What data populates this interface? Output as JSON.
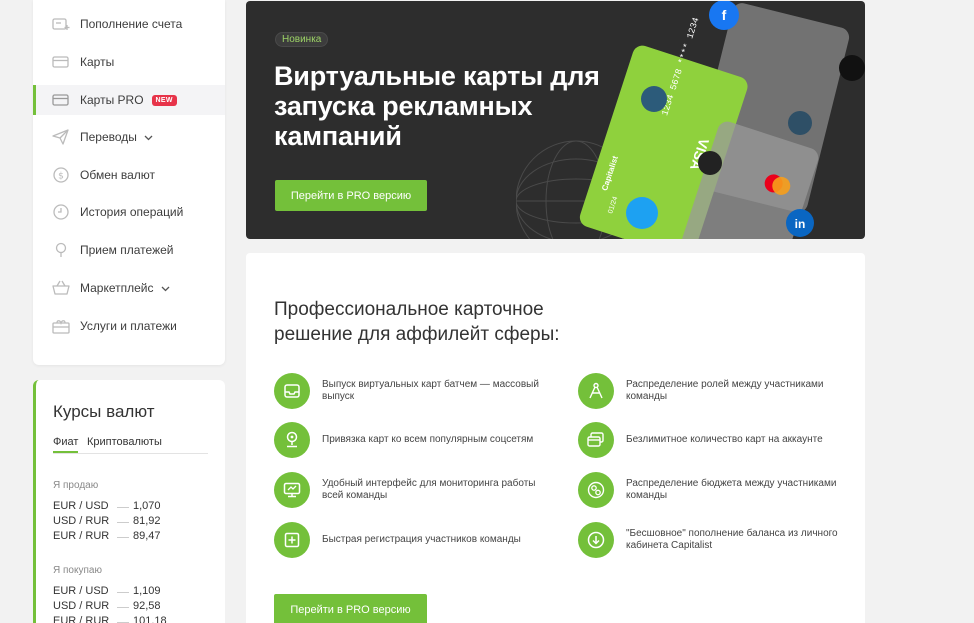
{
  "sidebar": {
    "items": [
      {
        "label": "Пополнение счета",
        "icon": "wallet-plus-icon"
      },
      {
        "label": "Карты",
        "icon": "card-icon"
      },
      {
        "label": "Карты PRO",
        "icon": "card-pro-icon",
        "badge": "NEW"
      },
      {
        "label": "Переводы",
        "icon": "send-icon"
      },
      {
        "label": "Обмен валют",
        "icon": "dollar-circle-icon"
      },
      {
        "label": "История операций",
        "icon": "clock-icon"
      },
      {
        "label": "Прием платежей",
        "icon": "pin-icon"
      },
      {
        "label": "Маркетплейс",
        "icon": "basket-icon"
      },
      {
        "label": "Услуги и платежи",
        "icon": "gift-icon"
      }
    ]
  },
  "rates": {
    "title": "Курсы валют",
    "tabs": [
      "Фиат",
      "Криптовалюты"
    ],
    "sell_label": "Я продаю",
    "buy_label": "Я покупаю",
    "sell": [
      {
        "pair": "EUR / USD",
        "value": "1,070"
      },
      {
        "pair": "USD / RUR",
        "value": "81,92"
      },
      {
        "pair": "EUR / RUR",
        "value": "89,47"
      }
    ],
    "buy": [
      {
        "pair": "EUR / USD",
        "value": "1,109"
      },
      {
        "pair": "USD / RUR",
        "value": "92,58"
      },
      {
        "pair": "EUR / RUR",
        "value": "101,18"
      }
    ]
  },
  "banner": {
    "tag": "Новинка",
    "title": "Виртуальные карты для запуска рекламных кампаний",
    "button": "Перейти в PRO версию",
    "card_brand": "Capitalist",
    "card_network": "VISA",
    "card_number": "1234 5678 **** 1234",
    "card_expiry": "01/24"
  },
  "features": {
    "title": "Профессиональное карточное решение для аффилейт сферы:",
    "items": [
      {
        "text": "Выпуск виртуальных карт батчем — массовый выпуск",
        "icon": "inbox-tray-icon"
      },
      {
        "text": "Распределение ролей между участниками команды",
        "icon": "compass-icon"
      },
      {
        "text": "Привязка карт ко всем популярным соцсетям",
        "icon": "location-pin-icon"
      },
      {
        "text": "Безлимитное количество карт на аккаунте",
        "icon": "cards-stack-icon"
      },
      {
        "text": "Удобный интерфейс для мониторинга работы всей команды",
        "icon": "monitor-icon"
      },
      {
        "text": "Распределение бюджета между участниками команды",
        "icon": "coins-circle-icon"
      },
      {
        "text": "Быстрая регистрация участников команды",
        "icon": "plus-square-icon"
      },
      {
        "text": "\"Бесшовное\" пополнение баланса из личного кабинета Capitalist",
        "icon": "download-circle-icon"
      }
    ],
    "button": "Перейти в PRO версию"
  },
  "colors": {
    "accent": "#74c03a",
    "banner_bg": "#2d2d2d",
    "badge_new": "#e7344a"
  }
}
